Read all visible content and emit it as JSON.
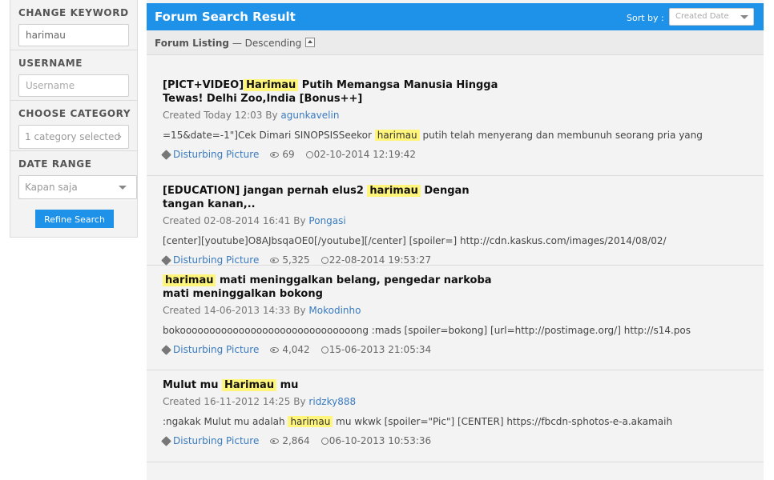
{
  "sidebar": {
    "keyword_label": "CHANGE KEYWORD",
    "keyword_value": "harimau",
    "username_label": "USERNAME",
    "username_placeholder": "Username",
    "category_label": "CHOOSE CATEGORY",
    "category_value": "1 category selected",
    "date_label": "DATE RANGE",
    "date_value": "Kapan saja",
    "refine_button": "Refine Search"
  },
  "header": {
    "title": "Forum Search Result",
    "sort_label": "Sort by :",
    "sort_value": "Created Date"
  },
  "listing": {
    "label": "Forum Listing",
    "order": "— Descending"
  },
  "results": [
    {
      "title_pre": "[PICT+VIDEO]",
      "title_hl": "Harimau",
      "title_post": "Putih Memangsa Manusia Hingga Tewas! Delhi Zoo,India [Bonus++]",
      "created_prefix": "Created Today 12:03 By",
      "author": "agunkavelin",
      "snippet_pre": "=15&date=-1\"]Cek Dimari SINOPSISSeekor",
      "snippet_hl": "harimau",
      "snippet_post": "putih telah menyerang dan membunuh seorang pria yang",
      "category": "Disturbing Picture",
      "views": "69",
      "last_post": "02-10-2014 12:19:42"
    },
    {
      "title_pre": "[EDUCATION] jangan pernah elus2",
      "title_hl": "harimau",
      "title_post": "Dengan tangan kanan,..",
      "created_prefix": "Created 02-08-2014 16:41 By",
      "author": "Pongasi",
      "snippet_pre": "[center][youtube]O8AJbsqaOE0[/youtube][/center] [spoiler=] http://cdn.kaskus.com/images/2014/08/02/",
      "snippet_hl": "",
      "snippet_post": "",
      "category": "Disturbing Picture",
      "views": "5,325",
      "last_post": "22-08-2014 19:53:27"
    },
    {
      "title_pre": "",
      "title_hl": "harimau",
      "title_post": "mati meninggalkan belang, pengedar narkoba mati meninggalkan bokong",
      "created_prefix": "Created 14-06-2013 14:33 By",
      "author": "Mokodinho",
      "snippet_pre": "bokoooooooooooooooooooooooooooooong :mads [spoiler=bokong] [url=http://postimage.org/] http://s14.pos",
      "snippet_hl": "",
      "snippet_post": "",
      "category": "Disturbing Picture",
      "views": "4,042",
      "last_post": "15-06-2013 21:05:34"
    },
    {
      "title_pre": "Mulut mu",
      "title_hl": "Harimau",
      "title_post": "mu",
      "created_prefix": "Created 16-11-2012 14:25 By",
      "author": "ridzky888",
      "snippet_pre": ":ngakak Mulut mu adalah",
      "snippet_hl": "harimau",
      "snippet_post": "mu wkwk [spoiler=\"Pic\"] [CENTER] https://fbcdn-sphotos-e-a.akamaih",
      "category": "Disturbing Picture",
      "views": "2,864",
      "last_post": "06-10-2013 10:53:36"
    }
  ]
}
